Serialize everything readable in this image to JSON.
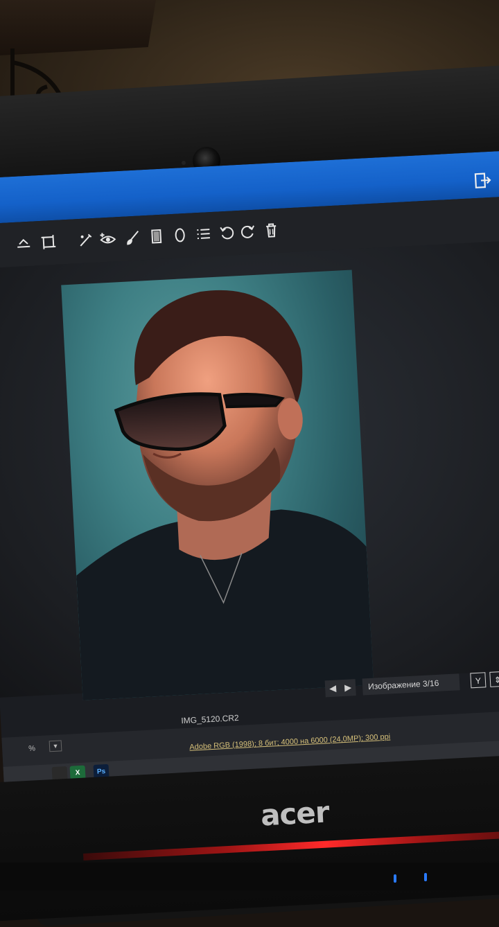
{
  "viewer": {
    "image_counter": "Изображение 3/16",
    "filename": "IMG_5120.CR2",
    "color_info": "Adobe RGB (1998); 8 бит; 4000 на 6000 (24,0MP); 300 ppi",
    "zoom_text": "%",
    "badge_y": "Y",
    "nav_prev": "◀",
    "nav_next": "▶"
  },
  "toolbar": {
    "tools": [
      "crop-icon",
      "straighten-icon",
      "transform-icon",
      "spot-removal-icon",
      "red-eye-icon",
      "brush-icon",
      "graduated-filter-icon",
      "radial-filter-icon",
      "list-icon",
      "rotate-left-icon",
      "rotate-right-icon",
      "trash-icon"
    ]
  },
  "taskbar": {
    "excel": "X",
    "photoshop": "Ps"
  },
  "laptop": {
    "brand": "acer"
  },
  "colors": {
    "titlebar": "#1e6fd6",
    "backdrop": "#3e7f84",
    "trim": "#ff2a2a"
  }
}
